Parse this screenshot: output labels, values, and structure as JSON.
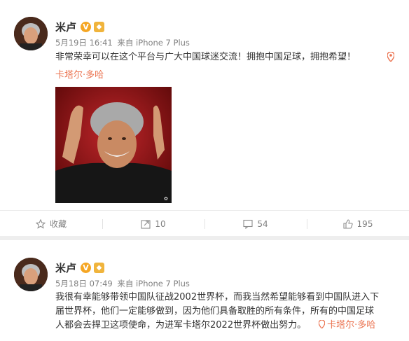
{
  "posts": [
    {
      "author": "米卢",
      "verified_badge": "V",
      "date": "5月19日 16:41",
      "source": "来自 iPhone 7 Plus",
      "text": "非常荣幸可以在这个平台与广大中国球迷交流！拥抱中国足球，拥抱希望！",
      "location": "卡塔尔·多哈",
      "location_icon": "location-pin-icon",
      "actions": {
        "favorite": "收藏",
        "repost_count": "10",
        "comment_count": "54",
        "like_count": "195"
      }
    },
    {
      "author": "米卢",
      "verified_badge": "V",
      "date": "5月18日 07:49",
      "source": "来自 iPhone 7 Plus",
      "text_line1": "我很有幸能够带领中国队征战2002世界杯，而我当然希望能够看到中国队进入下",
      "text_line2": "届世界杯，他们一定能够做到，因为他们具备取胜的所有条件，所有的中国足球",
      "text_line3": "人都会去捍卫这项使命，为进军卡塔尔2022世界杯做出努力。",
      "location": "卡塔尔·多哈"
    }
  ],
  "colors": {
    "link": "#eb7350",
    "meta": "#808080",
    "badge": "#f5a623"
  }
}
